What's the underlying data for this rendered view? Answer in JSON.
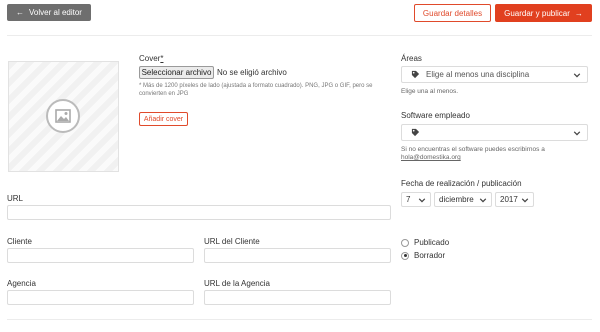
{
  "header": {
    "back_label": "Volver al editor",
    "save_label": "Guardar detalles",
    "publish_label": "Guardar y publicar"
  },
  "cover": {
    "label": "Cover",
    "required_mark": "*",
    "file_button": "Seleccionar archivo",
    "file_status": "No se eligió archivo",
    "hint": "* Más de 1200 píxeles de lado (ajustada a formato cuadrado). PNG, JPG o GIF, pero se convierten en JPG",
    "add_cover": "Añadir cover"
  },
  "fields": {
    "url_label": "URL",
    "client_label": "Cliente",
    "client_url_label": "URL del Cliente",
    "agency_label": "Agencia",
    "agency_url_label": "URL de la Agencia"
  },
  "areas": {
    "label": "Áreas",
    "placeholder": "Elige al menos una disciplina",
    "note": "Elige una al menos."
  },
  "software": {
    "label": "Software empleado",
    "note": "Si no encuentras el software puedes escribirnos a",
    "email": "hola@domestika.org"
  },
  "date": {
    "label": "Fecha de realización / publicación",
    "day": "7",
    "month": "diciembre",
    "year": "2017"
  },
  "status": {
    "option_published": "Publicado",
    "option_draft": "Borrador",
    "selected": "Borrador"
  },
  "colors": {
    "accent": "#e1401f",
    "back_button": "#6e6e6e"
  }
}
